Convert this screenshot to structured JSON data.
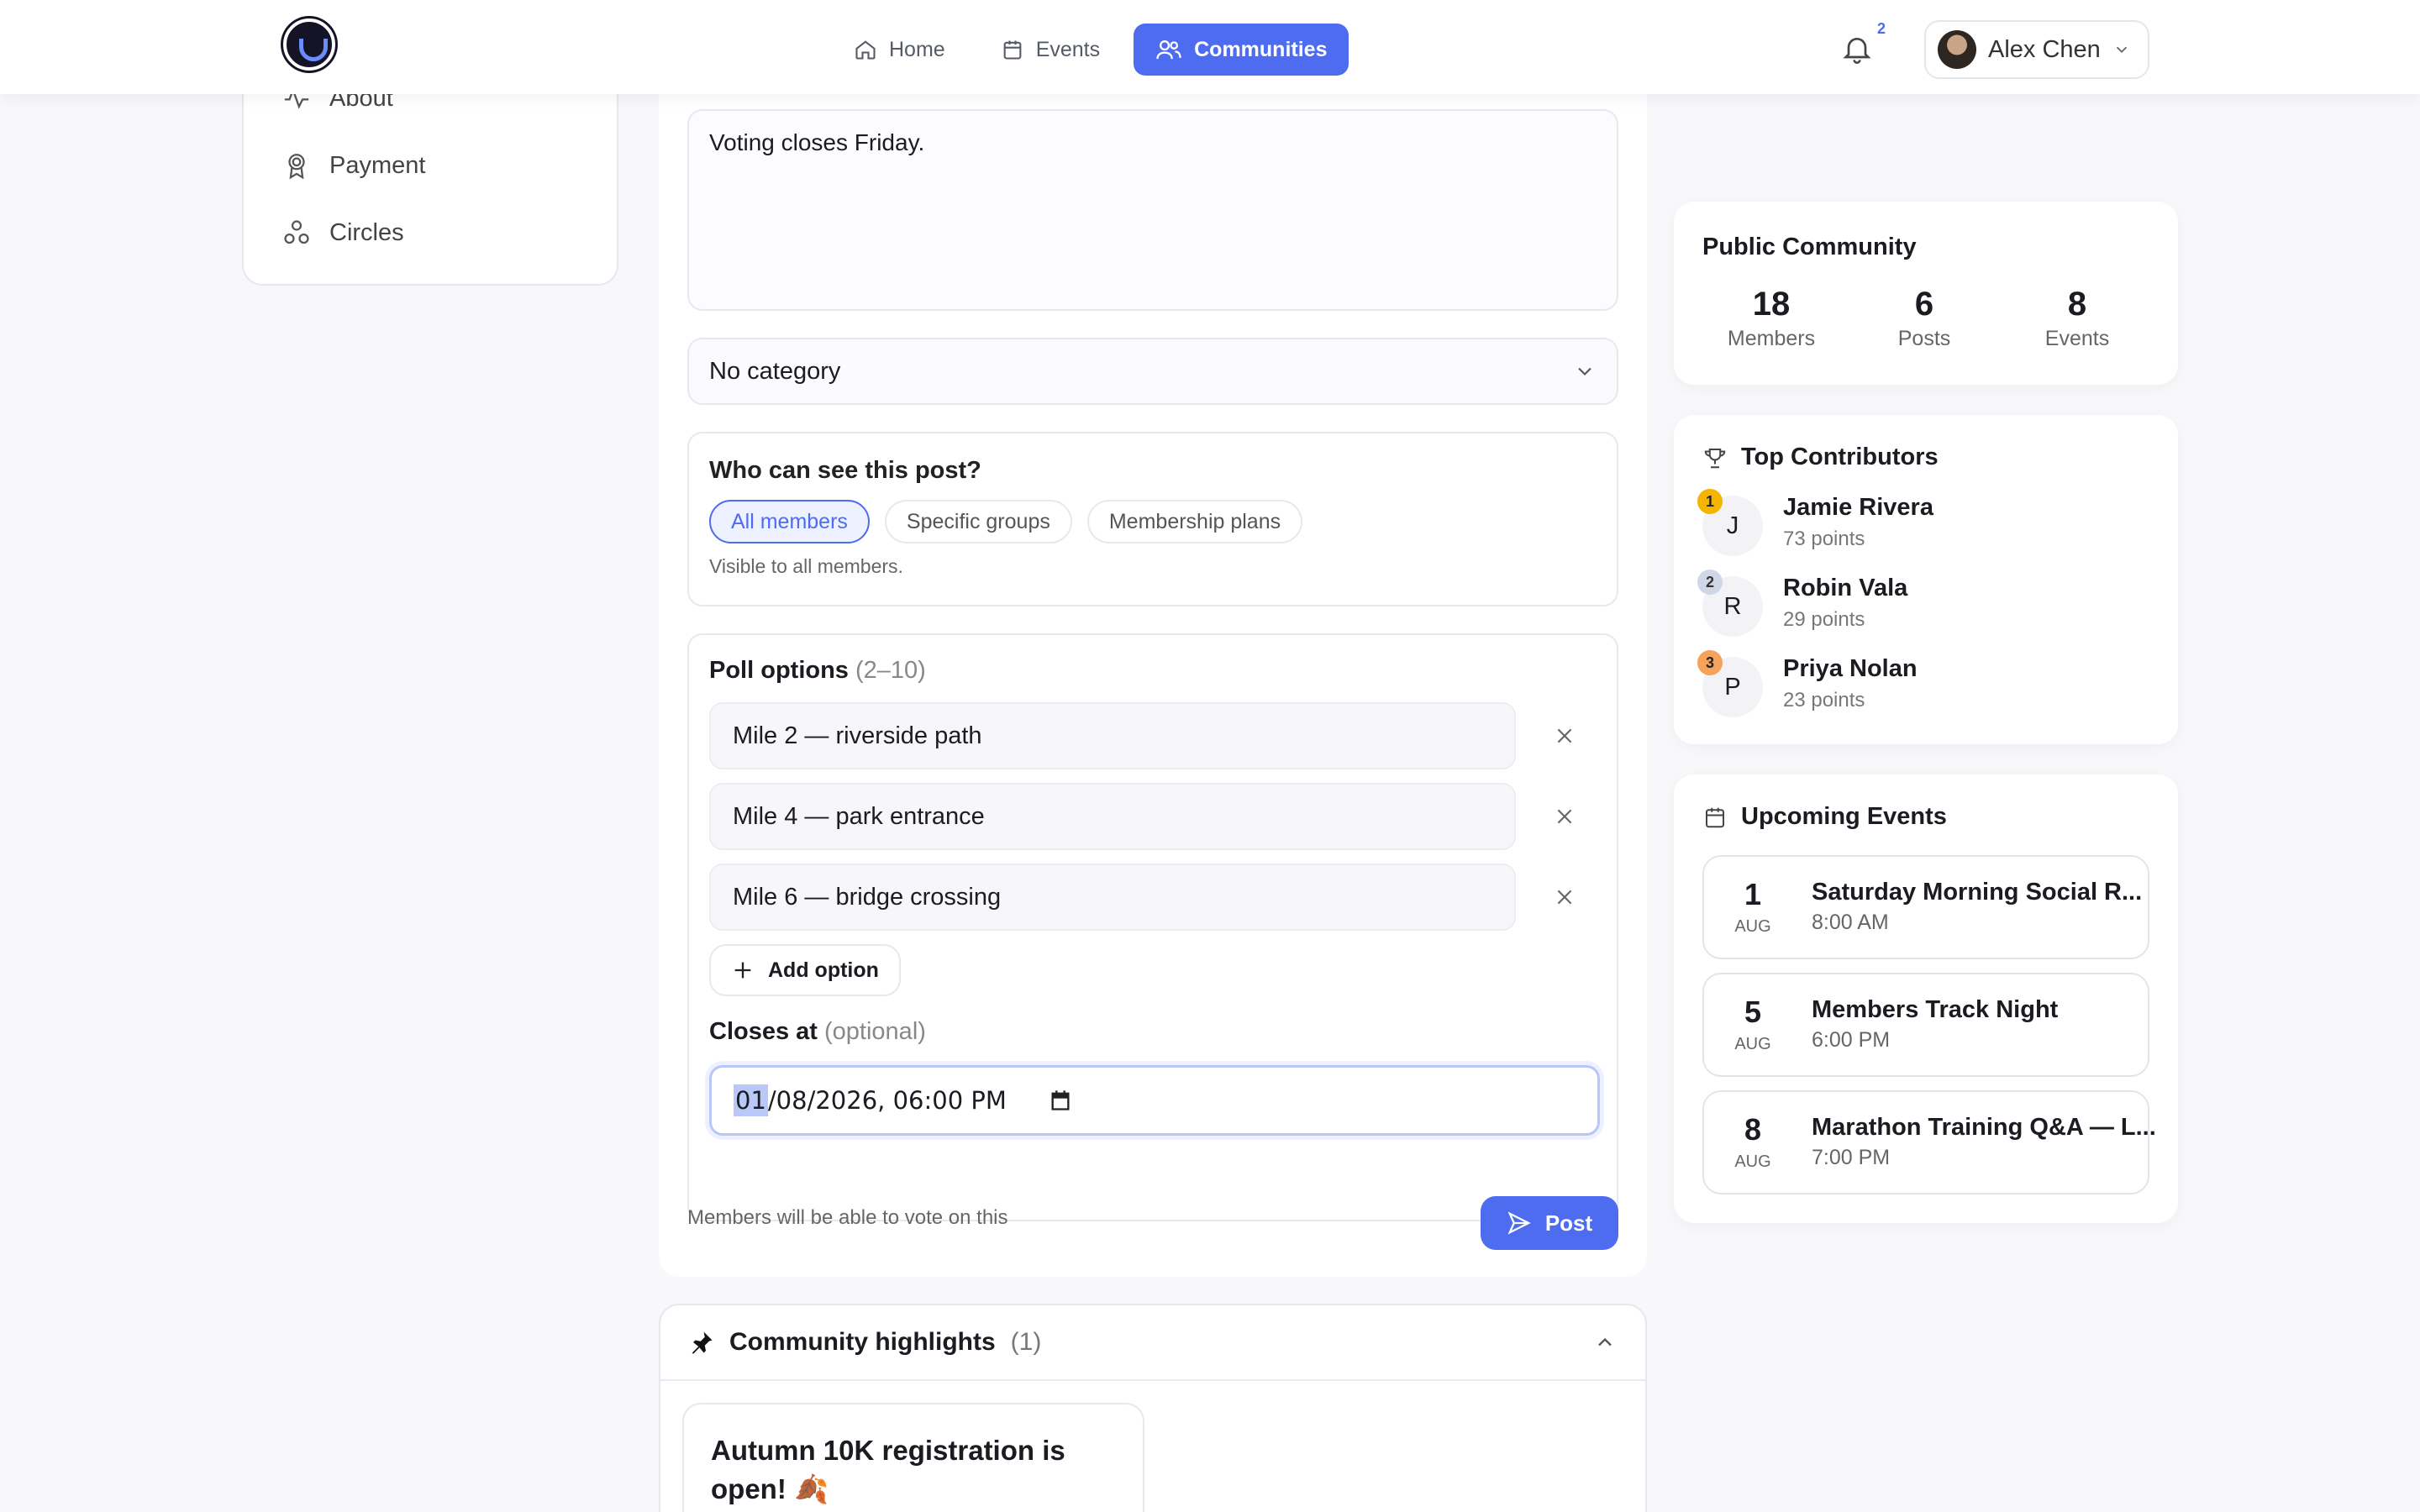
{
  "header": {
    "nav": [
      {
        "label": "Home",
        "icon": "home-icon"
      },
      {
        "label": "Events",
        "icon": "calendar-icon"
      },
      {
        "label": "Communities",
        "icon": "users-icon",
        "active": true
      }
    ],
    "notification_count": "2",
    "user_name": "Alex Chen"
  },
  "sidebar": {
    "items": [
      {
        "label": "About",
        "icon": "activity-icon"
      },
      {
        "label": "Payment",
        "icon": "award-icon"
      },
      {
        "label": "Circles",
        "icon": "circles-icon"
      }
    ]
  },
  "composer": {
    "body_text": "Voting closes Friday.",
    "category": "No category",
    "visibility": {
      "title": "Who can see this post?",
      "options": [
        "All members",
        "Specific groups",
        "Membership plans"
      ],
      "selected": "All members",
      "note": "Visible to all members."
    },
    "poll": {
      "title": "Poll options",
      "range": "(2–10)",
      "options": [
        "Mile 2 — riverside path",
        "Mile 4 — park entrance",
        "Mile 6 — bridge crossing"
      ],
      "add_label": "Add option",
      "closes_label": "Closes at",
      "closes_optional": "(optional)",
      "closes_month": "01",
      "closes_rest": "/08/2026, 06:00 PM"
    },
    "footer_note": "Members will be able to vote on this",
    "post_label": "Post"
  },
  "highlights": {
    "title": "Community highlights",
    "count": "(1)",
    "item_title": "Autumn 10K registration is open! 🍂"
  },
  "stats_card": {
    "title": "Public Community",
    "stats": [
      {
        "value": "18",
        "label": "Members"
      },
      {
        "value": "6",
        "label": "Posts"
      },
      {
        "value": "8",
        "label": "Events"
      }
    ]
  },
  "contributors": {
    "title": "Top Contributors",
    "items": [
      {
        "rank": "1",
        "initial": "J",
        "name": "Jamie Rivera",
        "points": "73 points",
        "badge_color": "#f5b400"
      },
      {
        "rank": "2",
        "initial": "R",
        "name": "Robin Vala",
        "points": "29 points",
        "badge_color": "#cfd6e6"
      },
      {
        "rank": "3",
        "initial": "P",
        "name": "Priya Nolan",
        "points": "23 points",
        "badge_color": "#f6a25a"
      }
    ]
  },
  "events": {
    "title": "Upcoming Events",
    "items": [
      {
        "day": "1",
        "month": "AUG",
        "name": "Saturday Morning Social R...",
        "time": "8:00 AM"
      },
      {
        "day": "5",
        "month": "AUG",
        "name": "Members Track Night",
        "time": "6:00 PM"
      },
      {
        "day": "8",
        "month": "AUG",
        "name": "Marathon Training Q&A — L...",
        "time": "7:00 PM"
      }
    ]
  }
}
